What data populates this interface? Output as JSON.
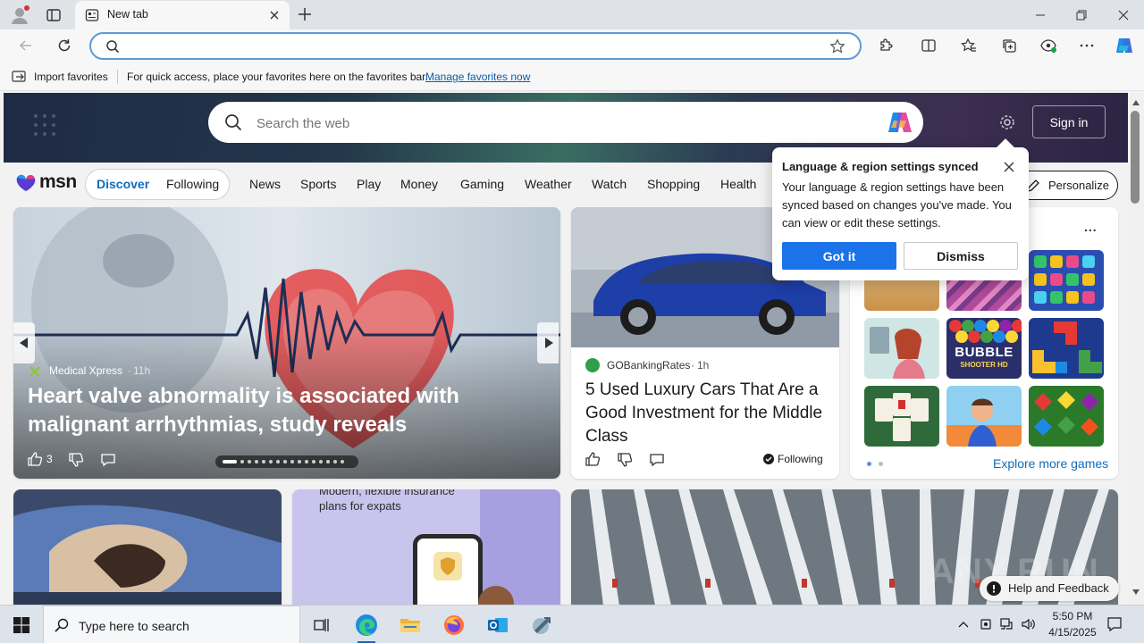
{
  "browser": {
    "tab_title": "New tab",
    "address_value": "",
    "favorites_bar": {
      "import_label": "Import favorites",
      "hint_text": "For quick access, place your favorites here on the favorites bar.",
      "manage_link": "Manage favorites now"
    }
  },
  "msn": {
    "search_placeholder": "Search the web",
    "sign_in": "Sign in",
    "logo_text": "msn",
    "tabs": [
      "Discover",
      "Following"
    ],
    "nav": [
      "News",
      "Sports",
      "Play",
      "Money",
      "Gaming",
      "Weather",
      "Watch",
      "Shopping",
      "Health"
    ],
    "personalize": "Personalize",
    "popup": {
      "title": "Language & region settings synced",
      "body": "Your language & region settings have been synced based on changes you've made. You can view or edit these settings.",
      "got_it": "Got it",
      "dismiss": "Dismiss"
    },
    "hero_story": {
      "source": "Medical Xpress",
      "age": "11h",
      "title": "Heart valve abnormality is associated with malignant arrhythmias, study reveals",
      "likes": "3"
    },
    "car_story": {
      "source": "GOBankingRates",
      "age": "1h",
      "title": "5 Used Luxury Cars That Are a Good Investment for the Middle Class",
      "following": "Following"
    },
    "games": {
      "more_icon": "...",
      "explore": "Explore more games",
      "bubble_text": "BUBBLE",
      "bubble_sub": "SHOOTER HD"
    },
    "ad_card": {
      "text_line1": "Modern, flexible insurance",
      "text_line2": "plans for expats"
    },
    "help_feedback": "Help and Feedback",
    "watermark": "ANY.RUN"
  },
  "taskbar": {
    "search_placeholder": "Type here to search",
    "time": "5:50 PM",
    "date": "4/15/2025"
  },
  "colors": {
    "accent_blue": "#0f6cbd",
    "got_it_bg": "#1a73e8",
    "link_blue": "#0b5cad"
  }
}
